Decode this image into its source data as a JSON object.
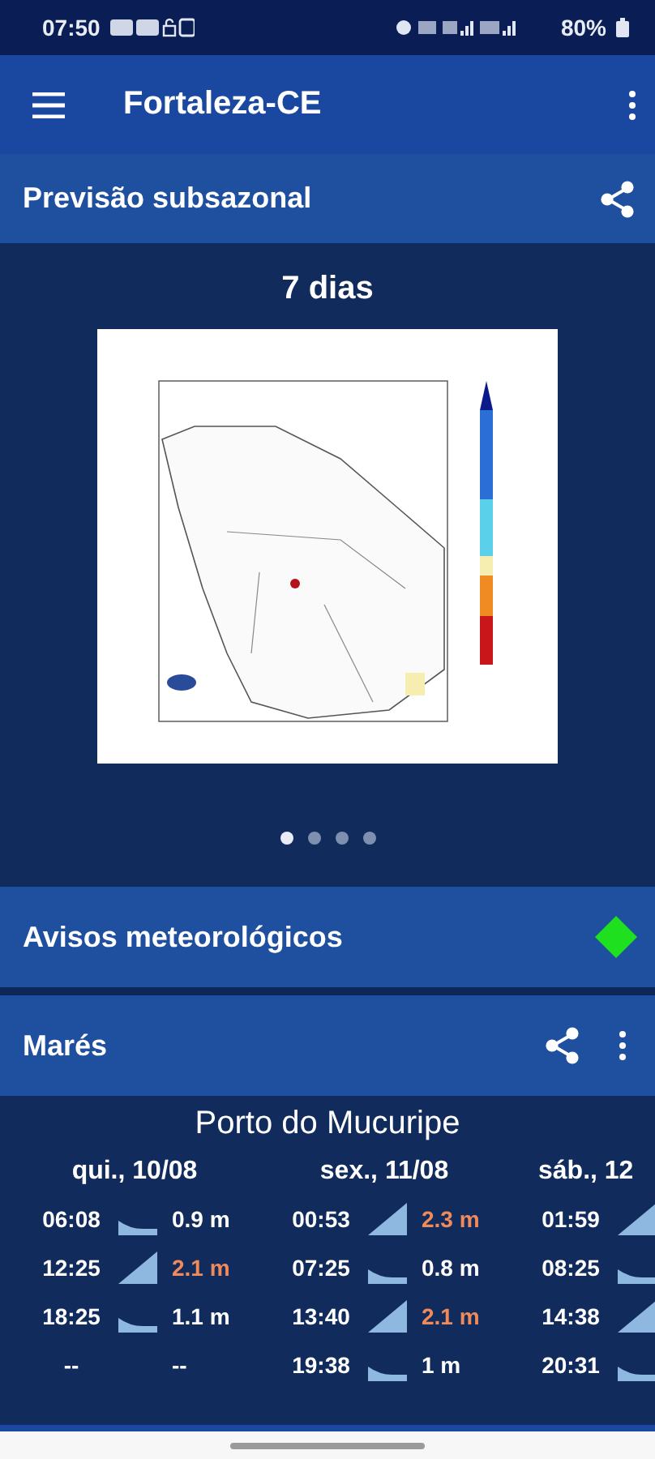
{
  "status_bar": {
    "time": "07:50",
    "battery": "80%"
  },
  "app_bar": {
    "title": "Fortaleza-CE"
  },
  "forecast": {
    "title": "Previsão subsazonal",
    "period": "7 dias",
    "pager": [
      {
        "selected": true
      },
      {
        "selected": false
      },
      {
        "selected": false
      },
      {
        "selected": false
      }
    ]
  },
  "warnings": {
    "title": "Avisos meteorológicos"
  },
  "tides": {
    "title": "Marés",
    "station": "Porto do Mucuripe",
    "days": [
      {
        "label": "qui., 10/08",
        "entries": [
          {
            "time": "06:08",
            "kind": "low",
            "height": "0.9 m"
          },
          {
            "time": "12:25",
            "kind": "high",
            "height": "2.1 m"
          },
          {
            "time": "18:25",
            "kind": "low",
            "height": "1.1 m"
          },
          {
            "time": "--",
            "kind": "none",
            "height": "--"
          }
        ]
      },
      {
        "label": "sex., 11/08",
        "entries": [
          {
            "time": "00:53",
            "kind": "high",
            "height": "2.3 m"
          },
          {
            "time": "07:25",
            "kind": "low",
            "height": "0.8 m"
          },
          {
            "time": "13:40",
            "kind": "high",
            "height": "2.1 m"
          },
          {
            "time": "19:38",
            "kind": "low",
            "height": "1 m"
          }
        ]
      },
      {
        "label": "sáb., 12",
        "entries": [
          {
            "time": "01:59",
            "kind": "high"
          },
          {
            "time": "08:25",
            "kind": "low"
          },
          {
            "time": "14:38",
            "kind": "high"
          },
          {
            "time": "20:31",
            "kind": "low"
          }
        ]
      }
    ]
  }
}
